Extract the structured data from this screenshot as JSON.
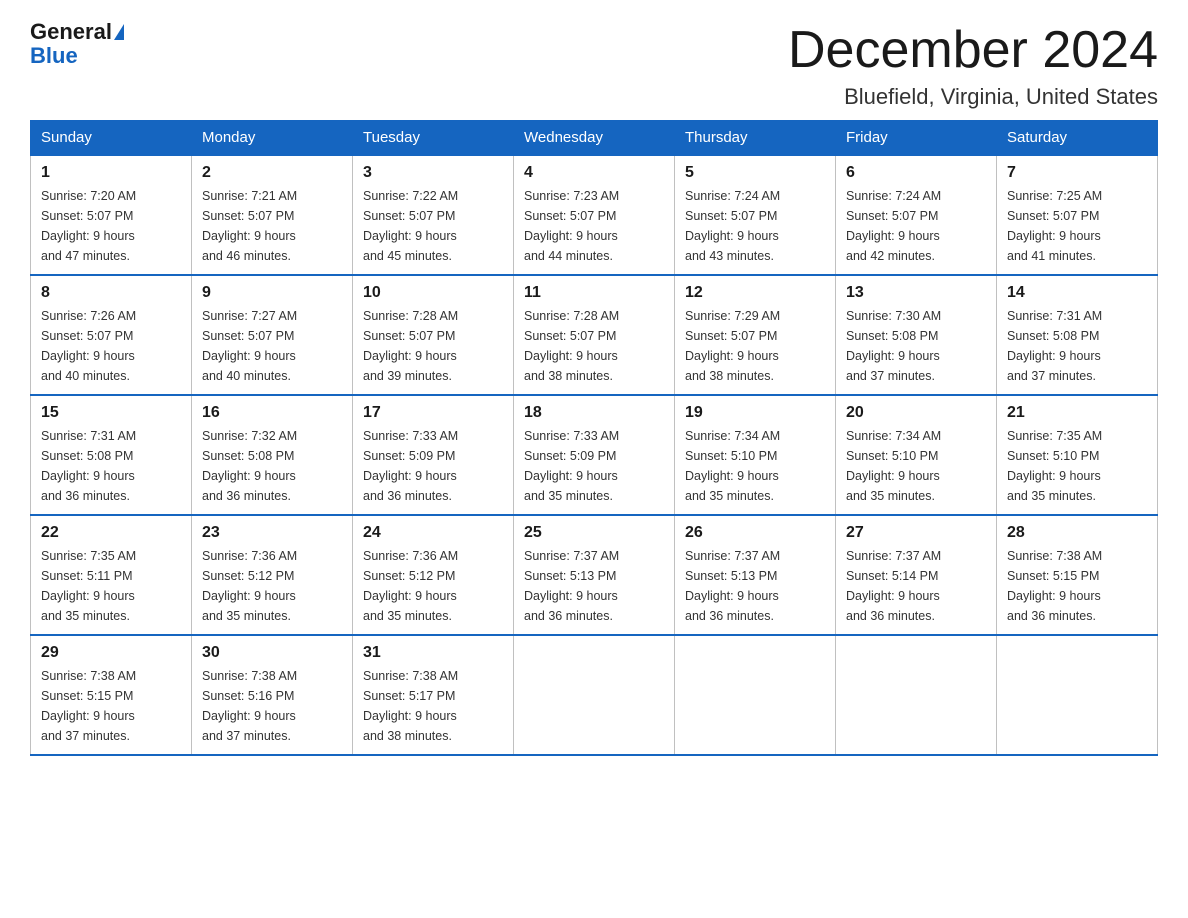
{
  "header": {
    "logo_general": "General",
    "logo_blue": "Blue",
    "title": "December 2024",
    "subtitle": "Bluefield, Virginia, United States"
  },
  "days_of_week": [
    "Sunday",
    "Monday",
    "Tuesday",
    "Wednesday",
    "Thursday",
    "Friday",
    "Saturday"
  ],
  "weeks": [
    [
      {
        "date": "1",
        "sunrise": "7:20 AM",
        "sunset": "5:07 PM",
        "daylight": "9 hours and 47 minutes."
      },
      {
        "date": "2",
        "sunrise": "7:21 AM",
        "sunset": "5:07 PM",
        "daylight": "9 hours and 46 minutes."
      },
      {
        "date": "3",
        "sunrise": "7:22 AM",
        "sunset": "5:07 PM",
        "daylight": "9 hours and 45 minutes."
      },
      {
        "date": "4",
        "sunrise": "7:23 AM",
        "sunset": "5:07 PM",
        "daylight": "9 hours and 44 minutes."
      },
      {
        "date": "5",
        "sunrise": "7:24 AM",
        "sunset": "5:07 PM",
        "daylight": "9 hours and 43 minutes."
      },
      {
        "date": "6",
        "sunrise": "7:24 AM",
        "sunset": "5:07 PM",
        "daylight": "9 hours and 42 minutes."
      },
      {
        "date": "7",
        "sunrise": "7:25 AM",
        "sunset": "5:07 PM",
        "daylight": "9 hours and 41 minutes."
      }
    ],
    [
      {
        "date": "8",
        "sunrise": "7:26 AM",
        "sunset": "5:07 PM",
        "daylight": "9 hours and 40 minutes."
      },
      {
        "date": "9",
        "sunrise": "7:27 AM",
        "sunset": "5:07 PM",
        "daylight": "9 hours and 40 minutes."
      },
      {
        "date": "10",
        "sunrise": "7:28 AM",
        "sunset": "5:07 PM",
        "daylight": "9 hours and 39 minutes."
      },
      {
        "date": "11",
        "sunrise": "7:28 AM",
        "sunset": "5:07 PM",
        "daylight": "9 hours and 38 minutes."
      },
      {
        "date": "12",
        "sunrise": "7:29 AM",
        "sunset": "5:07 PM",
        "daylight": "9 hours and 38 minutes."
      },
      {
        "date": "13",
        "sunrise": "7:30 AM",
        "sunset": "5:08 PM",
        "daylight": "9 hours and 37 minutes."
      },
      {
        "date": "14",
        "sunrise": "7:31 AM",
        "sunset": "5:08 PM",
        "daylight": "9 hours and 37 minutes."
      }
    ],
    [
      {
        "date": "15",
        "sunrise": "7:31 AM",
        "sunset": "5:08 PM",
        "daylight": "9 hours and 36 minutes."
      },
      {
        "date": "16",
        "sunrise": "7:32 AM",
        "sunset": "5:08 PM",
        "daylight": "9 hours and 36 minutes."
      },
      {
        "date": "17",
        "sunrise": "7:33 AM",
        "sunset": "5:09 PM",
        "daylight": "9 hours and 36 minutes."
      },
      {
        "date": "18",
        "sunrise": "7:33 AM",
        "sunset": "5:09 PM",
        "daylight": "9 hours and 35 minutes."
      },
      {
        "date": "19",
        "sunrise": "7:34 AM",
        "sunset": "5:10 PM",
        "daylight": "9 hours and 35 minutes."
      },
      {
        "date": "20",
        "sunrise": "7:34 AM",
        "sunset": "5:10 PM",
        "daylight": "9 hours and 35 minutes."
      },
      {
        "date": "21",
        "sunrise": "7:35 AM",
        "sunset": "5:10 PM",
        "daylight": "9 hours and 35 minutes."
      }
    ],
    [
      {
        "date": "22",
        "sunrise": "7:35 AM",
        "sunset": "5:11 PM",
        "daylight": "9 hours and 35 minutes."
      },
      {
        "date": "23",
        "sunrise": "7:36 AM",
        "sunset": "5:12 PM",
        "daylight": "9 hours and 35 minutes."
      },
      {
        "date": "24",
        "sunrise": "7:36 AM",
        "sunset": "5:12 PM",
        "daylight": "9 hours and 35 minutes."
      },
      {
        "date": "25",
        "sunrise": "7:37 AM",
        "sunset": "5:13 PM",
        "daylight": "9 hours and 36 minutes."
      },
      {
        "date": "26",
        "sunrise": "7:37 AM",
        "sunset": "5:13 PM",
        "daylight": "9 hours and 36 minutes."
      },
      {
        "date": "27",
        "sunrise": "7:37 AM",
        "sunset": "5:14 PM",
        "daylight": "9 hours and 36 minutes."
      },
      {
        "date": "28",
        "sunrise": "7:38 AM",
        "sunset": "5:15 PM",
        "daylight": "9 hours and 36 minutes."
      }
    ],
    [
      {
        "date": "29",
        "sunrise": "7:38 AM",
        "sunset": "5:15 PM",
        "daylight": "9 hours and 37 minutes."
      },
      {
        "date": "30",
        "sunrise": "7:38 AM",
        "sunset": "5:16 PM",
        "daylight": "9 hours and 37 minutes."
      },
      {
        "date": "31",
        "sunrise": "7:38 AM",
        "sunset": "5:17 PM",
        "daylight": "9 hours and 38 minutes."
      },
      null,
      null,
      null,
      null
    ]
  ],
  "labels": {
    "sunrise_prefix": "Sunrise: ",
    "sunset_prefix": "Sunset: ",
    "daylight_prefix": "Daylight: "
  }
}
